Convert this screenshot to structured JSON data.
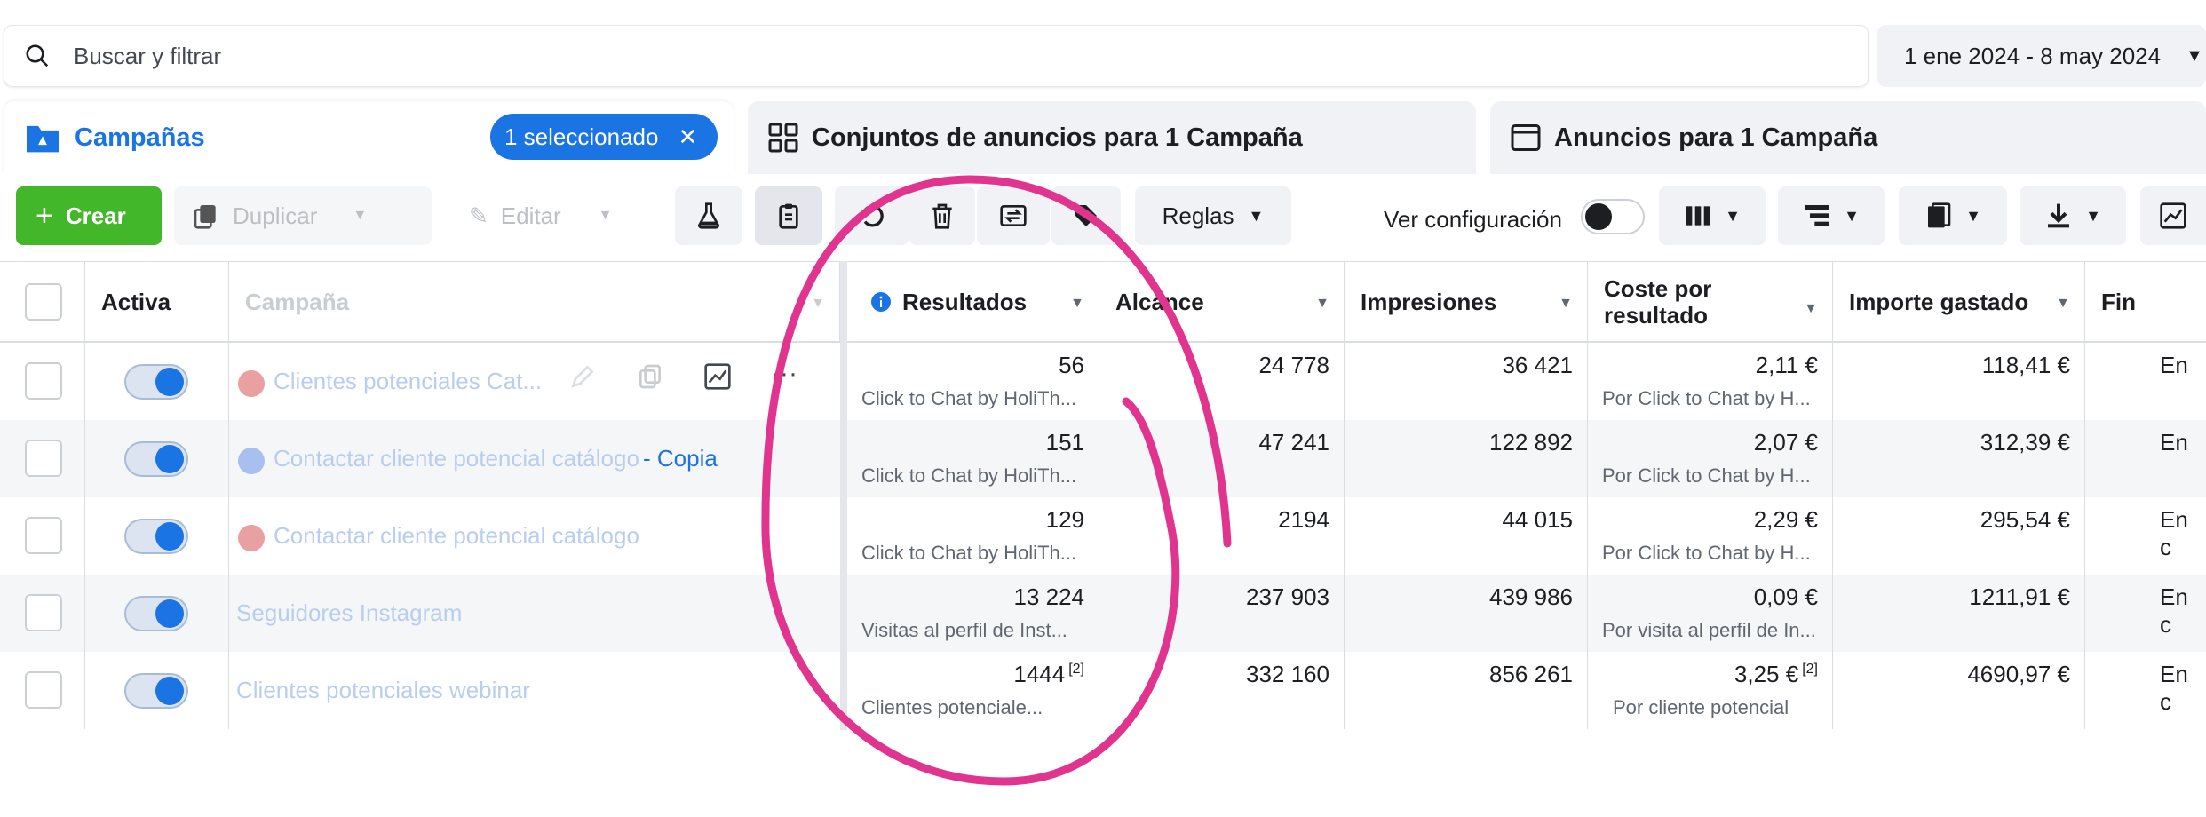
{
  "search": {
    "placeholder": "Buscar y filtrar"
  },
  "date_range": "1 ene 2024 - 8 may 2024",
  "tabs": {
    "campaigns": "Campañas",
    "selected_pill": "1 seleccionado",
    "adsets": "Conjuntos de anuncios para 1 Campaña",
    "ads": "Anuncios para 1 Campaña"
  },
  "toolbar": {
    "create": "Crear",
    "duplicate": "Duplicar",
    "edit": "Editar",
    "rules": "Reglas",
    "view_config": "Ver configuración"
  },
  "columns": {
    "active": "Activa",
    "campaign": "Campaña",
    "results": "Resultados",
    "reach": "Alcance",
    "impressions": "Impresiones",
    "cost_per_result_1": "Coste por",
    "cost_per_result_2": "resultado",
    "amount_spent": "Importe gastado",
    "end": "Fin"
  },
  "rows": [
    {
      "dot": "#e8a0a0",
      "name": "Clientes potenciales Cat...",
      "name_tail": "",
      "results": "56",
      "results_note": "",
      "results_sub": "Click to Chat by HoliTh...",
      "reach": "24 778",
      "impressions": "36 421",
      "cpr": "2,11 €",
      "cpr_note": "",
      "cpr_sub": "Por Click to Chat by H...",
      "spent": "118,41 €",
      "end": "En"
    },
    {
      "dot": "#a9bff0",
      "name": "Contactar cliente potencial catálogo ",
      "name_tail": "- Copia",
      "results": "151",
      "results_note": "",
      "results_sub": "Click to Chat by HoliTh...",
      "reach": "47 241",
      "impressions": "122 892",
      "cpr": "2,07 €",
      "cpr_note": "",
      "cpr_sub": "Por Click to Chat by H...",
      "spent": "312,39 €",
      "end": "En"
    },
    {
      "dot": "#e8a0a0",
      "name": "Contactar cliente potencial catálogo",
      "name_tail": "",
      "results": "129",
      "results_note": "",
      "results_sub": "Click to Chat by HoliTh...",
      "reach": "2194",
      "impressions": "44 015",
      "cpr": "2,29 €",
      "cpr_note": "",
      "cpr_sub": "Por Click to Chat by H...",
      "spent": "295,54 €",
      "end": "En c"
    },
    {
      "dot": "",
      "name": "Seguidores Instagram",
      "name_tail": "",
      "results": "13 224",
      "results_note": "",
      "results_sub": "Visitas al perfil de Inst...",
      "reach": "237 903",
      "impressions": "439 986",
      "cpr": "0,09 €",
      "cpr_note": "",
      "cpr_sub": "Por visita al perfil de In...",
      "spent": "1211,91 €",
      "end": "En c"
    },
    {
      "dot": "",
      "name": "Clientes potenciales webinar",
      "name_tail": "",
      "results": "1444",
      "results_note": "[2]",
      "results_sub": "Clientes potenciale...",
      "reach": "332 160",
      "impressions": "856 261",
      "cpr": "3,25 €",
      "cpr_note": "[2]",
      "cpr_sub": "Por cliente potencial",
      "spent": "4690,97 €",
      "end": "En c"
    }
  ],
  "colors": {
    "accent": "#1b74e4",
    "create": "#42b72a",
    "annotation": "#e0348f"
  }
}
